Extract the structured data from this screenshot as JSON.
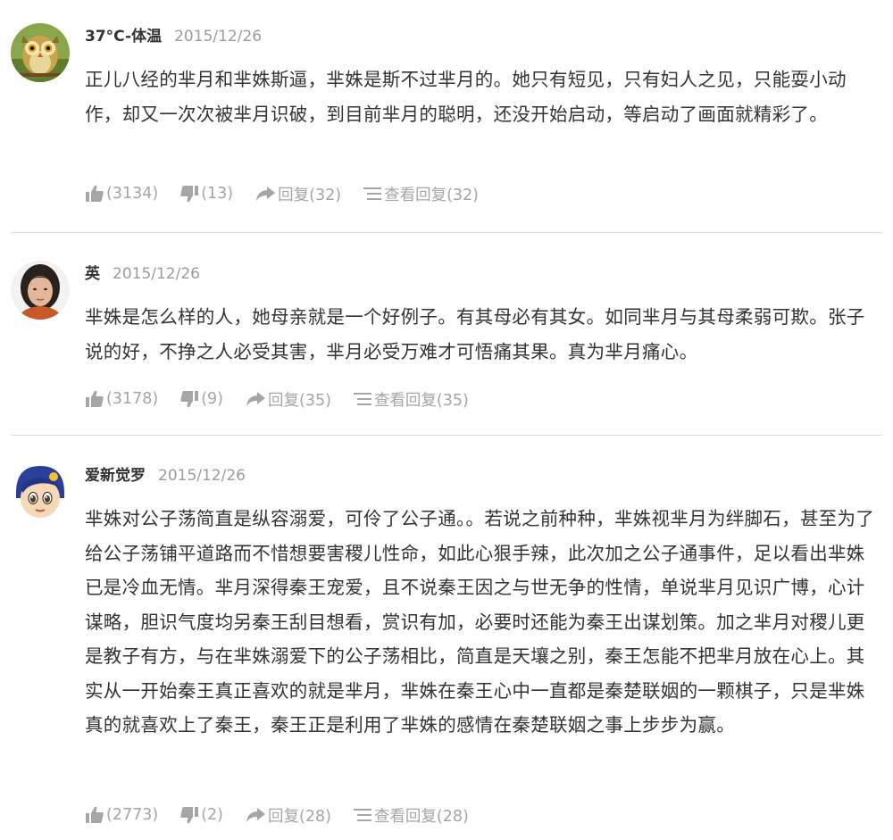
{
  "comments": [
    {
      "user": "37°C-体温",
      "date": "2015/12/26",
      "text": "正儿八经的芈月和芈姝斯逼，芈姝是斯不过芈月的。她只有短见，只有妇人之见，只能耍小动作，却又一次次被芈月识破，到目前芈月的聪明，还没开始启动，等启动了画面就精彩了。",
      "likes": "(3134)",
      "dislikes": "(13)",
      "reply": "回复(32)",
      "view_replies": "查看回复(32)"
    },
    {
      "user": "英",
      "date": "2015/12/26",
      "text": "芈姝是怎么样的人，她母亲就是一个好例子。有其母必有其女。如同芈月与其母柔弱可欺。张子说的好，不挣之人必受其害，芈月必受万难才可悟痛其果。真为芈月痛心。",
      "likes": "(3178)",
      "dislikes": "(9)",
      "reply": "回复(35)",
      "view_replies": "查看回复(35)"
    },
    {
      "user": "爱新觉罗",
      "date": "2015/12/26",
      "text": "芈姝对公子荡简直是纵容溺爱，可伶了公子通。。若说之前种种，芈姝视芈月为绊脚石，甚至为了给公子荡铺平道路而不惜想要害稷儿性命，如此心狠手辣，此次加之公子通事件，足以看出芈姝已是冷血无情。芈月深得秦王宠爱，且不说秦王因之与世无争的性情，单说芈月见识广博，心计谋略，胆识气度均另秦王刮目想看，赏识有加，必要时还能为秦王出谋划策。加之芈月对稷儿更是教子有方，与在芈姝溺爱下的公子荡相比，简直是天壤之别，秦王怎能不把芈月放在心上。其实从一开始秦王真正喜欢的就是芈月，芈姝在秦王心中一直都是秦楚联姻的一颗棋子，只是芈姝真的就喜欢上了秦王，秦王正是利用了芈姝的感情在秦楚联姻之事上步步为赢。",
      "likes": "(2773)",
      "dislikes": "(2)",
      "reply": "回复(28)",
      "view_replies": "查看回复(28)"
    }
  ],
  "icons": {
    "like": "thumbs-up-icon",
    "dislike": "thumbs-down-icon",
    "reply": "share-arrow-icon",
    "view": "list-lines-icon"
  },
  "colors": {
    "meta": "#a5a5a5",
    "text": "#333333",
    "date": "#9c9c9c",
    "divider": "#dcdcdc"
  }
}
